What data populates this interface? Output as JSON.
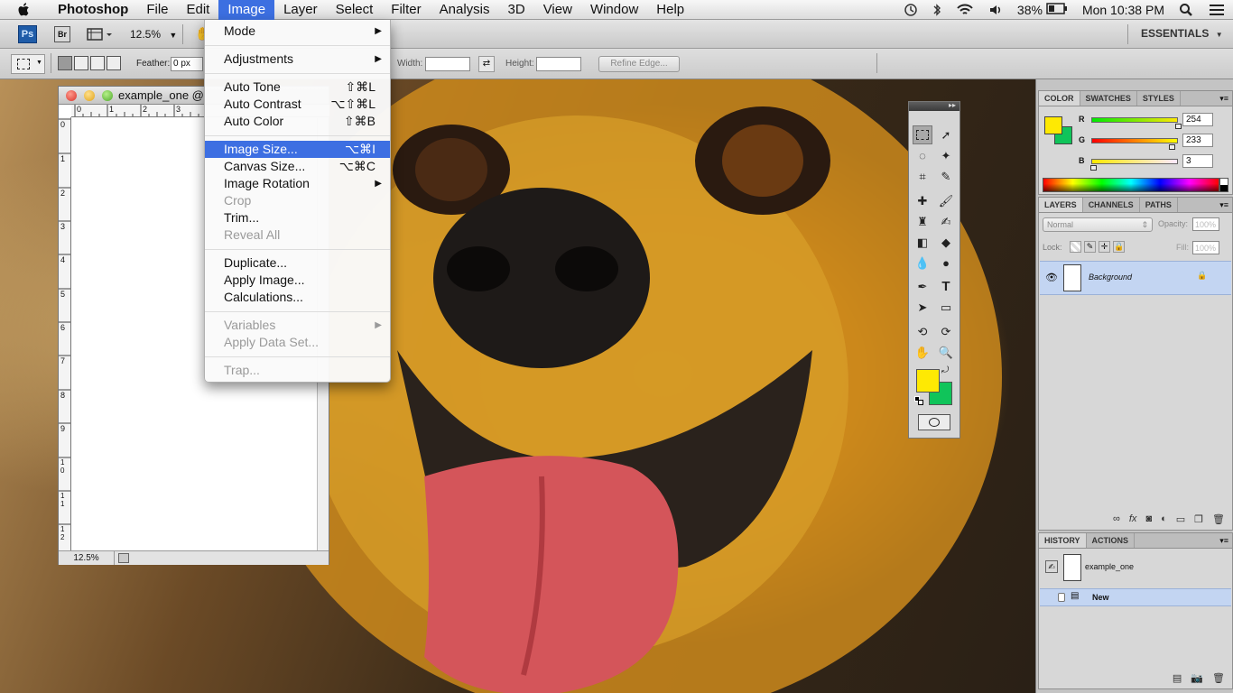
{
  "menubar": {
    "app_name": "Photoshop",
    "menus": [
      "File",
      "Edit",
      "Image",
      "Layer",
      "Select",
      "Filter",
      "Analysis",
      "3D",
      "View",
      "Window",
      "Help"
    ],
    "active_menu": "Image",
    "battery": "38%",
    "clock": "Mon 10:38 PM"
  },
  "appbar": {
    "ps_logo": "Ps",
    "br_logo": "Br",
    "zoom": "12.5%",
    "workspace": "ESSENTIALS"
  },
  "optbar": {
    "feather_label": "Feather:",
    "feather_value": "0 px",
    "width_label": "Width:",
    "height_label": "Height:",
    "refine_edge": "Refine Edge..."
  },
  "document": {
    "title": "example_one @",
    "zoom": "12.5%",
    "ruler_top": [
      "0",
      "1",
      "2",
      "3"
    ],
    "ruler_left": [
      "0",
      "1",
      "2",
      "3",
      "4",
      "5",
      "6",
      "7",
      "8",
      "9",
      "10",
      "11",
      "12"
    ]
  },
  "image_menu": {
    "items": [
      {
        "label": "Mode",
        "submenu": true
      },
      {
        "label": "Adjustments",
        "submenu": true
      },
      {
        "label": "Auto Tone",
        "shortcut": "⇧⌘L"
      },
      {
        "label": "Auto Contrast",
        "shortcut": "⌥⇧⌘L"
      },
      {
        "label": "Auto Color",
        "shortcut": "⇧⌘B"
      },
      {
        "label": "Image Size...",
        "shortcut": "⌥⌘I",
        "highlighted": true
      },
      {
        "label": "Canvas Size...",
        "shortcut": "⌥⌘C"
      },
      {
        "label": "Image Rotation",
        "submenu": true
      },
      {
        "label": "Crop",
        "disabled": true
      },
      {
        "label": "Trim..."
      },
      {
        "label": "Reveal All",
        "disabled": true
      },
      {
        "label": "Duplicate..."
      },
      {
        "label": "Apply Image..."
      },
      {
        "label": "Calculations..."
      },
      {
        "label": "Variables",
        "submenu": true,
        "disabled": true
      },
      {
        "label": "Apply Data Set...",
        "disabled": true
      },
      {
        "label": "Trap...",
        "disabled": true
      }
    ]
  },
  "tools_panel": {
    "type_tool": "T"
  },
  "color_panel": {
    "tabs": [
      "COLOR",
      "SWATCHES",
      "STYLES"
    ],
    "r_label": "R",
    "g_label": "G",
    "b_label": "B",
    "r": "254",
    "g": "233",
    "b": "3",
    "foreground": "#fee903",
    "background": "#10c45a"
  },
  "layers_panel": {
    "tabs": [
      "LAYERS",
      "CHANNELS",
      "PATHS"
    ],
    "blend_mode": "Normal",
    "opacity_label": "Opacity:",
    "opacity_value": "100%",
    "lock_label": "Lock:",
    "fill_label": "Fill:",
    "fill_value": "100%",
    "layer_name": "Background"
  },
  "history_panel": {
    "tabs": [
      "HISTORY",
      "ACTIONS"
    ],
    "snapshot": "example_one",
    "step": "New"
  }
}
